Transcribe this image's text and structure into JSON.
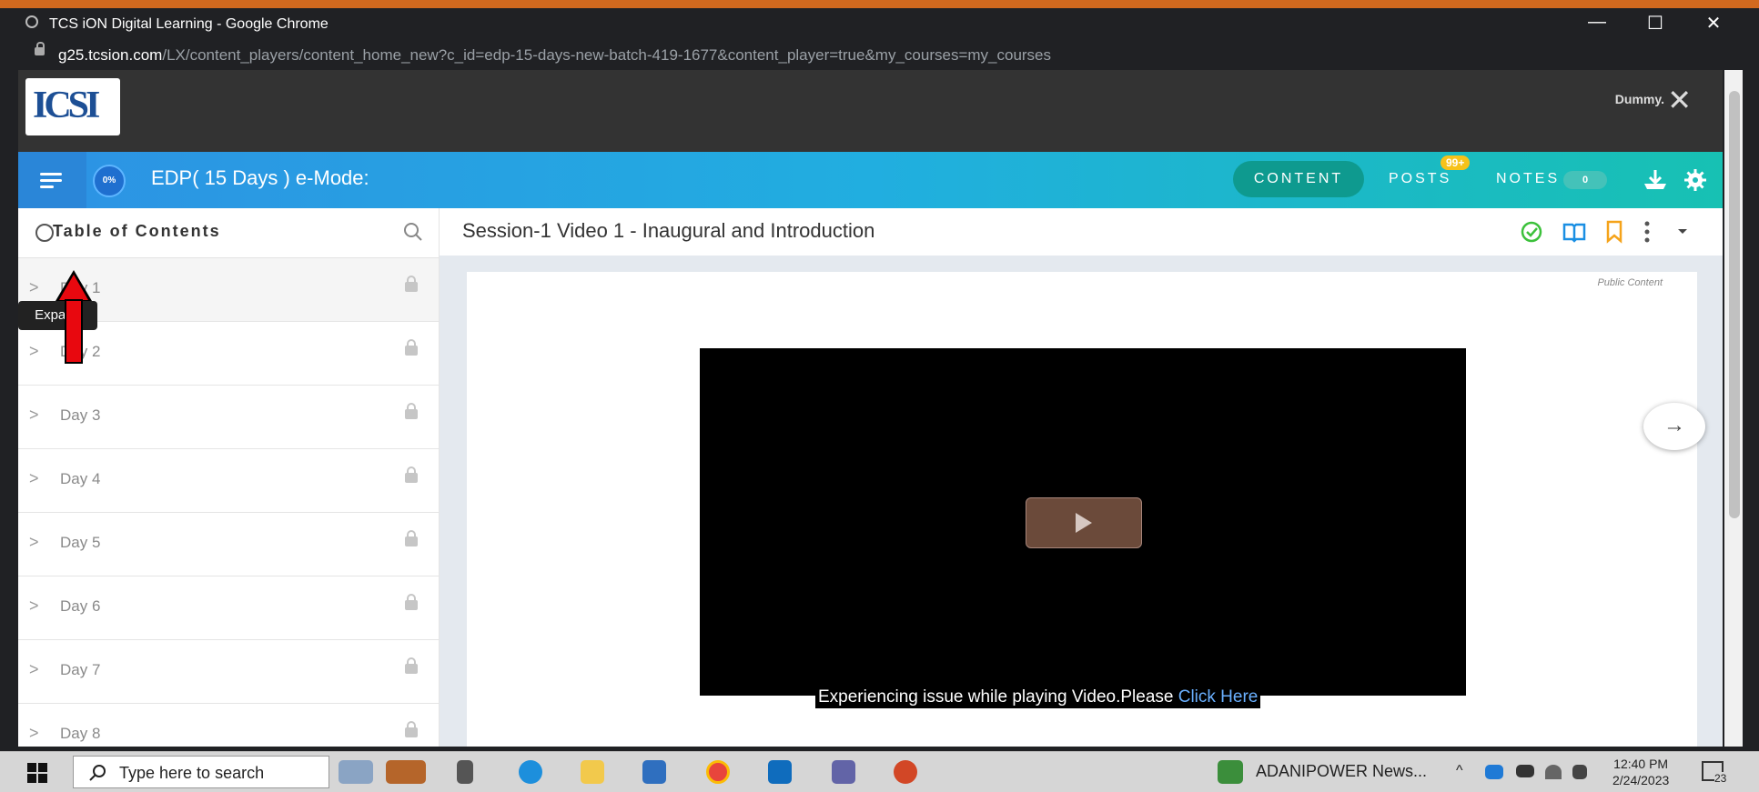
{
  "window": {
    "title": "TCS iON Digital Learning - Google Chrome",
    "url_domain": "g25.tcsion.com",
    "url_path": "/LX/content_players/content_home_new?c_id=edp-15-days-new-batch-419-1677&content_player=true&my_courses=my_courses",
    "minimize": "—",
    "maximize": "☐",
    "close": "✕"
  },
  "header": {
    "logo_text": "ICSI",
    "user_text": "Dummy.",
    "close": "✕"
  },
  "course_bar": {
    "progress": "0%",
    "course_title": "EDP( 15 Days ) e-Mode:",
    "tabs": {
      "content": "CONTENT",
      "posts": "POSTS",
      "posts_badge": "99+",
      "notes": "NOTES",
      "notes_count": "0"
    }
  },
  "sidebar": {
    "title": "Table of Contents",
    "tooltip": "Expand",
    "items": [
      {
        "label": "Day 1"
      },
      {
        "label": "Day 2"
      },
      {
        "label": "Day 3"
      },
      {
        "label": "Day 4"
      },
      {
        "label": "Day 5"
      },
      {
        "label": "Day 6"
      },
      {
        "label": "Day 7"
      },
      {
        "label": "Day 8"
      }
    ]
  },
  "main": {
    "session_title": "Session-1 Video 1 - Inaugural and Introduction",
    "public_label": "Public Content",
    "issue_text": "Experiencing issue while playing Video.Please ",
    "issue_link": "Click Here",
    "next": "→"
  },
  "taskbar": {
    "search_placeholder": "Type here to search",
    "news": "ADANIPOWER  News...",
    "time": "12:40 PM",
    "date": "2/24/2023",
    "notifications": "23"
  },
  "colors": {
    "accent_blue": "#2d92e4",
    "accent_teal": "#17c1b3",
    "annotation_arrow": "#e8080f"
  }
}
